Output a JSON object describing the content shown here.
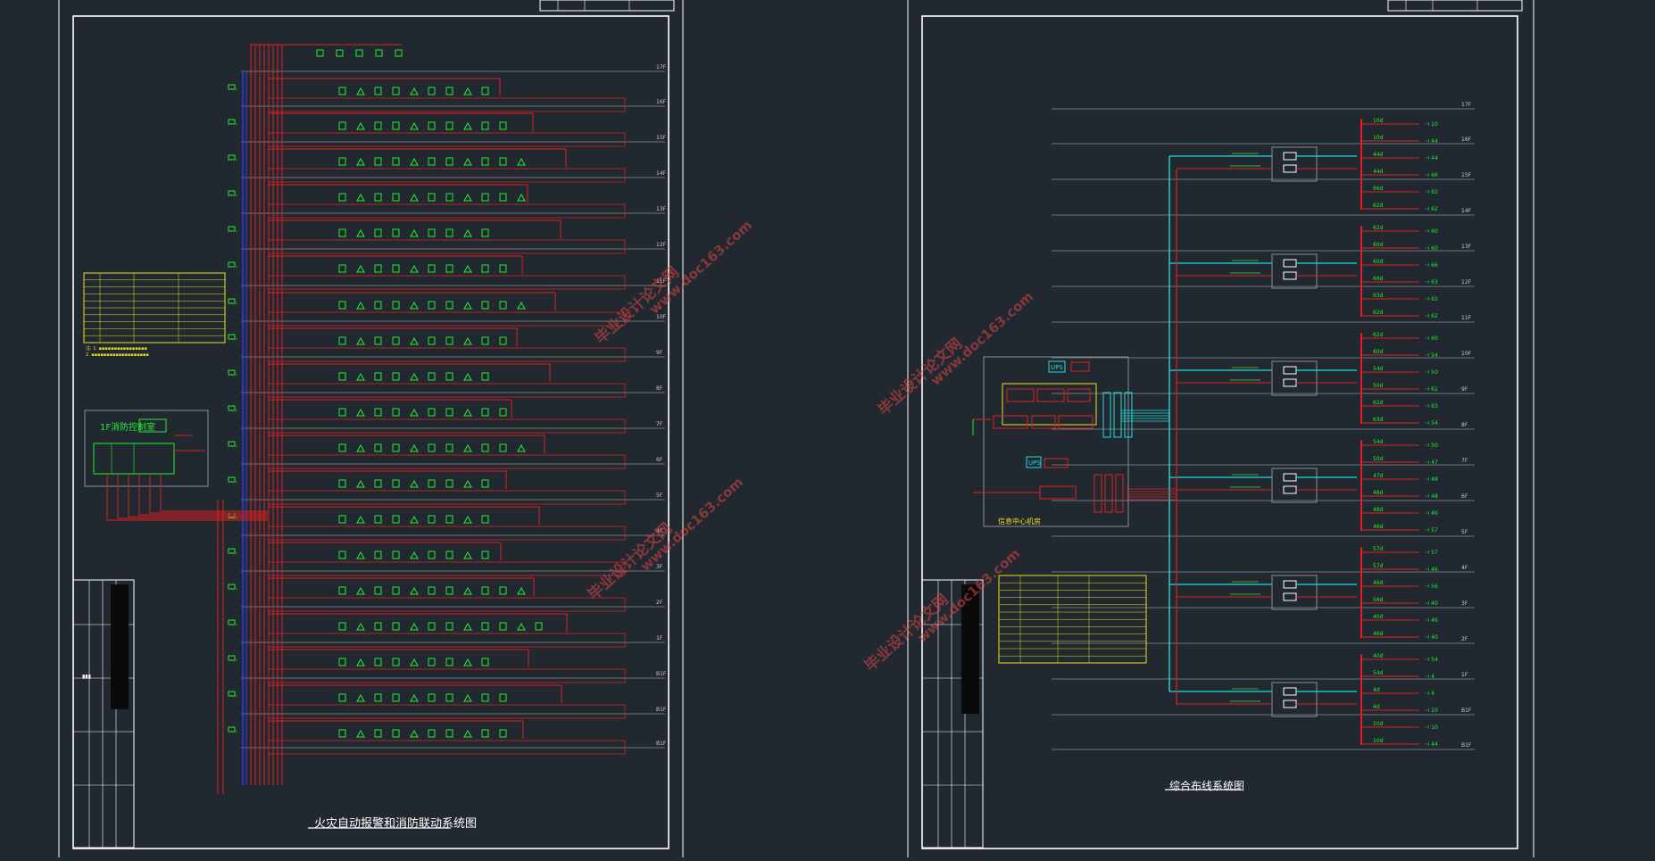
{
  "colors": {
    "background": "#212830",
    "frame": "#ffffff",
    "red_wire": "#e02020",
    "green_device": "#22ee33",
    "yellow_table": "#e8e020",
    "cyan_fiber": "#22dddd",
    "blue_bus": "#2a3cd8",
    "floor_line": "#8a8f96",
    "watermark": "#d04848"
  },
  "sheets": [
    {
      "title": "火灾自动报警和消防联动系统图",
      "control_room_label": "1F消防控制室",
      "floor_labels": [
        "17F",
        "16F",
        "15F",
        "14F",
        "13F",
        "12F",
        "11F",
        "10F",
        "9F",
        "8F",
        "7F",
        "6F",
        "5F",
        "4F",
        "3F",
        "2F",
        "1F",
        "B1F",
        "B1F"
      ]
    },
    {
      "title": "综合布线系统图",
      "floor_labels": [
        "17F",
        "16F",
        "15F",
        "14F",
        "13F",
        "12F",
        "11F",
        "10F",
        "9F",
        "8F",
        "7F",
        "6F",
        "5F",
        "4F",
        "3F",
        "2F",
        "1F",
        "B1F"
      ],
      "ups_label": "UPS",
      "center_label": "信息中心机房",
      "outlet_counts": [
        "10",
        "10",
        "44",
        "44",
        "66",
        "62",
        "62",
        "60",
        "60",
        "66",
        "63",
        "62",
        "62",
        "60",
        "54",
        "50",
        "62",
        "63",
        "54",
        "50",
        "47",
        "48",
        "48",
        "46",
        "57",
        "57",
        "46",
        "56",
        "40",
        "46",
        "40",
        "54",
        "4",
        "4"
      ]
    }
  ],
  "watermarks": [
    "毕业设计论文网",
    "www.doc163.com"
  ]
}
